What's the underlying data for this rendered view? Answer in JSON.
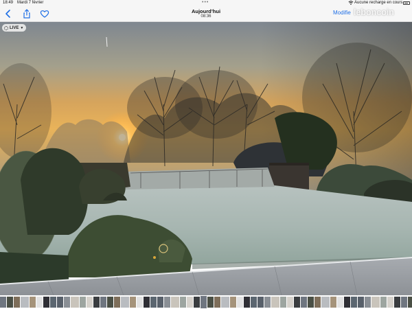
{
  "status_bar": {
    "time": "18:49",
    "date": "Mardi 7 février",
    "charging": "Aucune recharge en cours"
  },
  "toolbar": {
    "title": "Aujourd’hui",
    "subtitle": "08:36",
    "edit_label": "Modifie",
    "watermark": "leboncoin",
    "accent_color": "#1f6fe6"
  },
  "photo": {
    "live_label": "LIVE",
    "description_icons": [
      "live-photo-icon",
      "chevron-down-icon"
    ]
  },
  "icons": {
    "back": "chevron-left-icon",
    "share": "share-icon",
    "favorite": "heart-icon",
    "wifi": "wifi-icon",
    "battery": "battery-icon"
  }
}
